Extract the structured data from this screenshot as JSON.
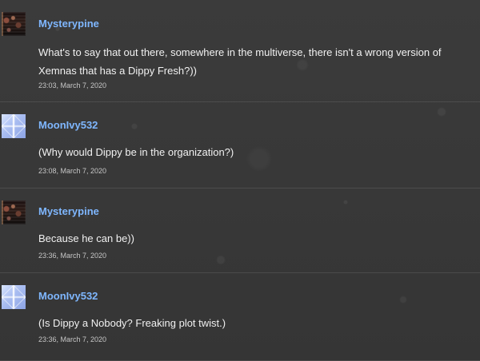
{
  "comments": [
    {
      "author": "Mysterypine",
      "avatar_icon": "mysterypine-avatar-icon",
      "message": "What's to say that out there, somewhere in the multiverse, there isn't a wrong version of Xemnas that has a Dippy Fresh?))",
      "timestamp": "23:03, March 7, 2020"
    },
    {
      "author": "MoonIvy532",
      "avatar_icon": "moonivy532-avatar-icon",
      "message": "(Why would Dippy be in the organization?)",
      "timestamp": "23:08, March 7, 2020"
    },
    {
      "author": "Mysterypine",
      "avatar_icon": "mysterypine-avatar-icon",
      "message": "Because he can be))",
      "timestamp": "23:36, March 7, 2020"
    },
    {
      "author": "MoonIvy532",
      "avatar_icon": "moonivy532-avatar-icon",
      "message": "(Is Dippy a Nobody? Freaking plot twist.)",
      "timestamp": "23:36, March 7, 2020"
    }
  ],
  "colors": {
    "background": "#3a3a3a",
    "author_link": "#7fb7ff",
    "message_text": "#f1f1f1",
    "timestamp_text": "#c7c7c7",
    "divider": "#5a5a5a"
  }
}
